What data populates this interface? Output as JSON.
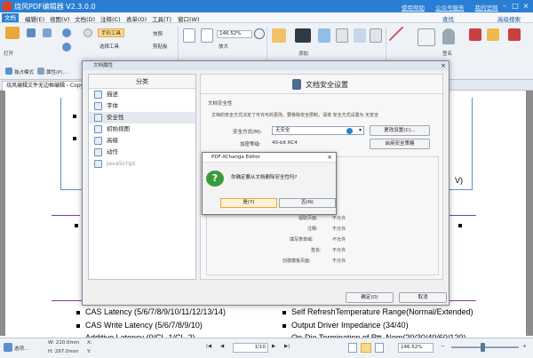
{
  "app": {
    "title": "烧风PDF编辑器 V2.3.0.0",
    "links": [
      "使用帮助",
      "公众号服务",
      "我的官网"
    ]
  },
  "menubar": {
    "items": [
      "文档",
      "编辑(E)",
      "视图(V)",
      "文档(D)",
      "注释(C)",
      "表单(O)",
      "工具(T)",
      "窗口(W)"
    ]
  },
  "ribbon": {
    "group1": {
      "copy": "粘贴",
      "open": "打开",
      "history": "历史"
    },
    "group2": {
      "hand": "手形工具",
      "select": "选择工具",
      "snapshot": "快照",
      "clipboard": "剪贴板",
      "zoom_in": "放大",
      "zoom_value": "146.52%"
    },
    "find": "查找",
    "advanced_search": "高级搜索",
    "annotate": "添加",
    "bookmark": "书签",
    "sticky": "签名",
    "insert": "插入",
    "properties": "属性",
    "single_page": "单页",
    "actual_size": "实际大小",
    "page_width": "适合宽度",
    "zoom_out": "缩小",
    "row2": {
      "independent": "独占模式",
      "attrs": "属性(P)..."
    }
  },
  "document_tab": "烧风编辑文件无边框编辑 - Copy.pdf",
  "page_text": {
    "b1": "CAS Latency (5/6/7/8/9/10/11/12/13/14)",
    "b2": "CAS Write Latency (5/6/7/8/9/10)",
    "b3": "Additive Latency (0/CL-1/CL-2)",
    "c1": "Self RefreshTemperature Range(Normal/Extended)",
    "c2": "Output Driver Impedance (34/40)",
    "c3": "On-Die Termination of Rtt_Nom(20/30/40/60/120)",
    "frag": "V)"
  },
  "doc_props": {
    "title": "文档属性",
    "nav_header": "分类",
    "nav_items": [
      {
        "label": "描述",
        "state": "normal"
      },
      {
        "label": "字体",
        "state": "normal"
      },
      {
        "label": "安全性",
        "state": "selected"
      },
      {
        "label": "初始视图",
        "state": "normal"
      },
      {
        "label": "高级",
        "state": "normal"
      },
      {
        "label": "动作",
        "state": "normal"
      },
      {
        "label": "JavaScript",
        "state": "disabled"
      }
    ],
    "panel_title": "文档安全设置",
    "section_label": "文档安全性",
    "description": "文档的安全方式决定了可许可的更改。要移除安全限制，请将 安全方式设置为 无安全",
    "method_label": "安全方式(M):",
    "method_value": "无安全",
    "change_settings": "更改设置(C)...",
    "encryption_label": "加密等级:",
    "encryption_value": "40-bit RC4",
    "show_details": "启用安全策略",
    "permissions": [
      {
        "label": "提取页面:",
        "value": "不允许"
      },
      {
        "label": "注释:",
        "value": "不允许"
      },
      {
        "label": "填写表单域:",
        "value": "不允许"
      },
      {
        "label": "签名:",
        "value": "不允许"
      },
      {
        "label": "创建模板页面:",
        "value": "不允许"
      }
    ],
    "ok": "确定(O)",
    "cancel": "取消"
  },
  "alert": {
    "title": "PDF-XChange Editor",
    "message": "你确定要从文档删除安全性吗?",
    "yes": "是(Y)",
    "no": "否(N)"
  },
  "status": {
    "options": "选项...",
    "width": "W: 210.0mm",
    "height": "H: 297.0mm",
    "x": "X:",
    "y": "Y:",
    "page": "1/10",
    "zoom": "146.52%"
  }
}
